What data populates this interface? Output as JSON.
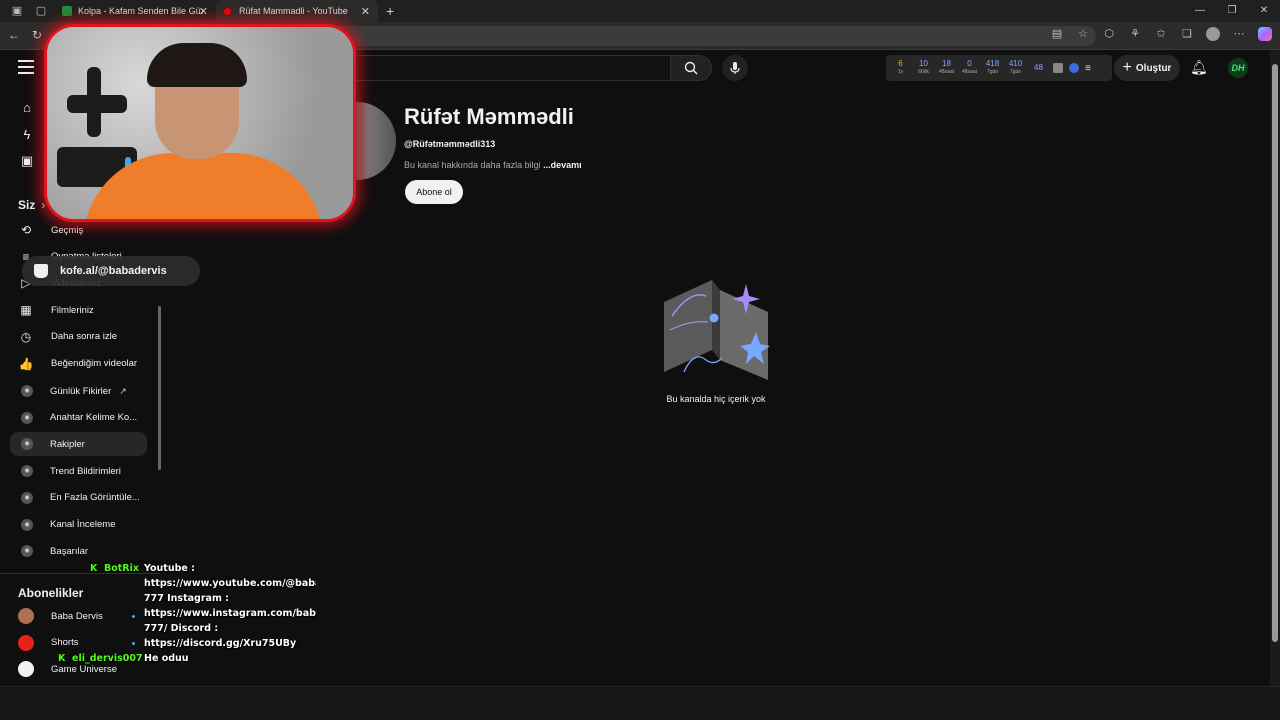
{
  "browser": {
    "tabs": [
      {
        "title": "Kolpa - Kafam Senden Bile Güzel",
        "active": false
      },
      {
        "title": "Rüfat Mammadli - YouTube",
        "active": true
      }
    ]
  },
  "masthead": {
    "stats": [
      {
        "value": "6",
        "label": "1y",
        "color": "orange"
      },
      {
        "value": "10",
        "label": "60dk",
        "color": "blue"
      },
      {
        "value": "18",
        "label": "48saat",
        "color": "blue"
      },
      {
        "value": "0",
        "label": "48saat",
        "color": "blue"
      },
      {
        "value": "418",
        "label": "7gün",
        "color": "blue"
      },
      {
        "value": "410",
        "label": "7gün",
        "color": "blue"
      },
      {
        "value": "48",
        "label": "",
        "color": "blue"
      }
    ],
    "create_label": "Oluştur",
    "avatar_text": "DH"
  },
  "sidebar": {
    "section_you": "Siz",
    "you_items": [
      {
        "label": "Geçmiş",
        "icon": "history-icon",
        "glyph": "⟲"
      },
      {
        "label": "Oynatma listeleri",
        "icon": "playlist-icon",
        "glyph": "≡"
      },
      {
        "label": "Videolarınız",
        "icon": "your-videos-icon",
        "glyph": "▷"
      },
      {
        "label": "Filmleriniz",
        "icon": "movies-icon",
        "glyph": "▦"
      },
      {
        "label": "Daha sonra izle",
        "icon": "clock-icon",
        "glyph": "◷"
      },
      {
        "label": "Beğendiğim videolar",
        "icon": "thumbs-up-icon",
        "glyph": "👍"
      }
    ],
    "ext_items": [
      {
        "label": "Günlük Fikirler",
        "external": true
      },
      {
        "label": "Anahtar Kelime Ko...",
        "external": false
      },
      {
        "label": "Rakipler",
        "external": false
      },
      {
        "label": "Trend Bildirimleri",
        "external": false
      },
      {
        "label": "En Fazla Görüntüle...",
        "external": false
      },
      {
        "label": "Kanal İnceleme",
        "external": false
      },
      {
        "label": "Başarılar",
        "external": false
      }
    ],
    "section_subs": "Abonelikler",
    "subscriptions": [
      {
        "label": "Baba Dervis",
        "color": "#b07050"
      },
      {
        "label": "Shorts",
        "color": "#e62117"
      },
      {
        "label": "Game Universe",
        "color": "#f1f1f1"
      }
    ]
  },
  "channel": {
    "name": "Rüfət Məmmədli",
    "handle": "@Rüfətməmmədli313",
    "description": "Bu kanal hakkında daha fazla bilgi",
    "more_label": "...devamı",
    "subscribe_label": "Abone ol",
    "empty_message": "Bu kanalda hiç içerik yok"
  },
  "overlay": {
    "donation_text": "kofe.al/@babadervis",
    "chat": [
      {
        "user": "BotRix",
        "lines": [
          "Youtube :",
          "https://www.youtube.com/@baba",
          "777 İnstagram :",
          "https://www.instagram.com/baba",
          "777/ Discord :",
          "https://discord.gg/Xru75UBy"
        ]
      },
      {
        "user": "eli_dervis007",
        "lines": [
          "He oduu"
        ]
      }
    ]
  }
}
